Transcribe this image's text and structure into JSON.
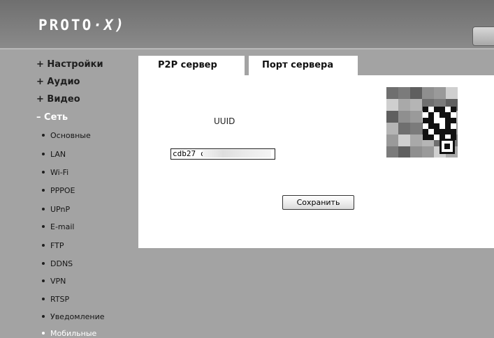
{
  "header": {
    "logo_text": "PROTO",
    "logo_x": "·X)",
    "brand_color": "#ffffff"
  },
  "sidebar": {
    "top_items": [
      {
        "label": "+ Настройки"
      },
      {
        "label": "+ Аудио"
      },
      {
        "label": "+ Видео"
      },
      {
        "label": "– Сеть",
        "active": true
      }
    ],
    "network_items": [
      {
        "label": "Основные"
      },
      {
        "label": "LAN"
      },
      {
        "label": "Wi-Fi"
      },
      {
        "label": "PPPOE"
      },
      {
        "label": "UPnP"
      },
      {
        "label": "E-mail"
      },
      {
        "label": "FTP"
      },
      {
        "label": "DDNS"
      },
      {
        "label": "VPN"
      },
      {
        "label": "RTSP"
      },
      {
        "label": "Уведомление"
      },
      {
        "label": "Мобильные",
        "active": true
      }
    ]
  },
  "tabs": [
    {
      "label": "P2P сервер",
      "selected": true
    },
    {
      "label": "Порт сервера",
      "selected": false
    }
  ],
  "p2p": {
    "uuid_label": "UUID",
    "uuid_value": "cdb27                         c",
    "qr_icon": "qr-code-icon",
    "save_label": "Сохранить"
  }
}
